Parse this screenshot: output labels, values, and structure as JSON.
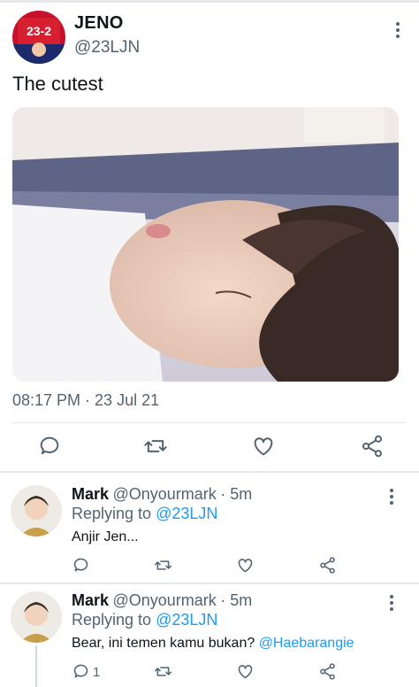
{
  "main_tweet": {
    "author_name": "JENO",
    "author_handle": "@23LJN",
    "text": "The cutest",
    "timestamp": "08:17 PM · 23 Jul 21",
    "jersey_text": "23-2"
  },
  "replies": [
    {
      "author_name": "Mark",
      "author_handle": "@Onyourmark",
      "time": "· 5m",
      "replying_prefix": "Replying to ",
      "replying_to": "@23LJN",
      "text": "Anjir Jen...",
      "mention": ""
    },
    {
      "author_name": "Mark",
      "author_handle": "@Onyourmark",
      "time": "· 5m",
      "replying_prefix": "Replying to ",
      "replying_to": "@23LJN",
      "text": "Bear, ini temen kamu bukan? ",
      "mention": "@Haebarangie",
      "reply_count": "1"
    }
  ],
  "icons": [
    "reply-icon",
    "retweet-icon",
    "like-icon",
    "share-icon",
    "more-icon"
  ],
  "colors": {
    "accent": "#1d9bf0",
    "muted": "#536471",
    "divider": "#e6e9ec"
  }
}
